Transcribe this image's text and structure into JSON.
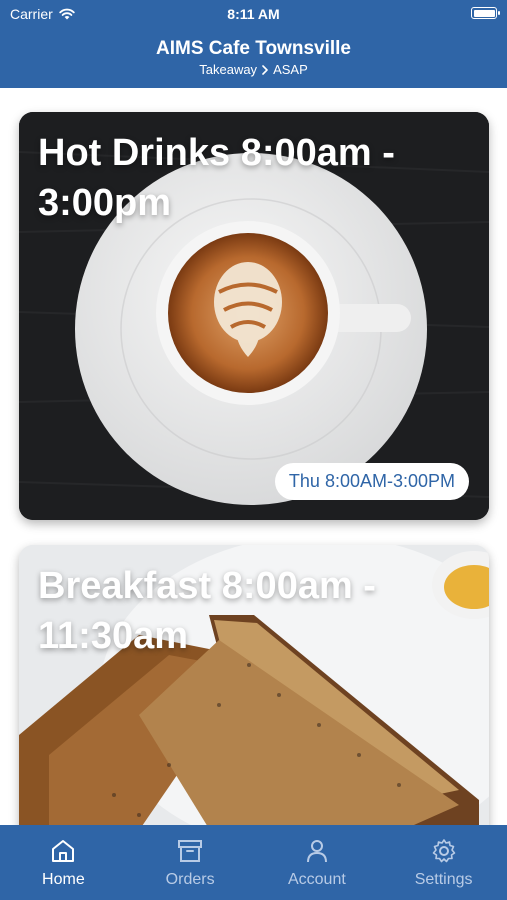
{
  "status_bar": {
    "carrier": "Carrier",
    "time": "8:11 AM"
  },
  "header": {
    "title": "AIMS Cafe Townsville",
    "order_type": "Takeaway",
    "order_time": "ASAP"
  },
  "menus": [
    {
      "title": "Hot Drinks 8:00am - 3:00pm",
      "hours": "Thu 8:00AM-3:00PM",
      "image": "latte-art-cup"
    },
    {
      "title": "Breakfast 8:00am - 11:30am",
      "image": "toast-slices"
    }
  ],
  "tabbar": {
    "active": "Home",
    "tabs": [
      {
        "label": "Home",
        "icon": "home-icon"
      },
      {
        "label": "Orders",
        "icon": "archive-box-icon"
      },
      {
        "label": "Account",
        "icon": "person-icon"
      },
      {
        "label": "Settings",
        "icon": "gear-icon"
      }
    ]
  },
  "colors": {
    "brand": "#2f65a7",
    "tab_inactive": "#b8cbe6",
    "white": "#ffffff"
  }
}
